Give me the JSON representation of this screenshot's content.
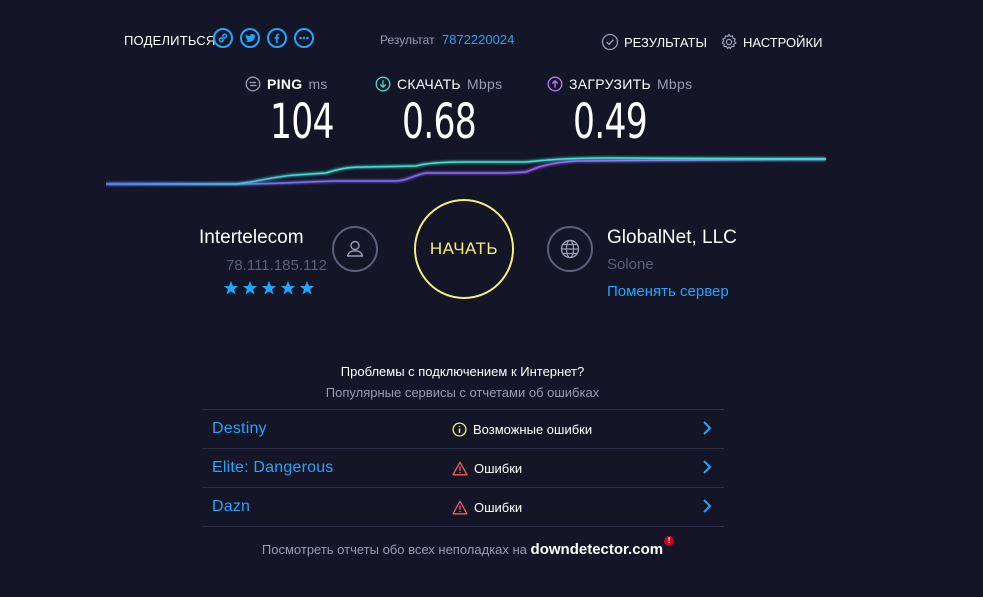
{
  "header": {
    "share_label": "ПОДЕЛИТЬСЯ",
    "share_icons": [
      "link-icon",
      "twitter-icon",
      "facebook-icon",
      "more-icon"
    ],
    "result_label": "Результат",
    "result_id": "7872220024",
    "results_label": "РЕЗУЛЬТАТЫ",
    "settings_label": "НАСТРОЙКИ"
  },
  "metrics": {
    "ping": {
      "label": "PING",
      "unit": "ms",
      "value": "104"
    },
    "download": {
      "label": "СКАЧАТЬ",
      "unit": "Mbps",
      "value": "0.68"
    },
    "upload": {
      "label": "ЗАГРУЗИТЬ",
      "unit": "Mbps",
      "value": "0.49"
    }
  },
  "colors": {
    "accent": "#1ea7ff",
    "download_line": "#3ee0d0",
    "upload_line": "#9b5cf5",
    "start_button": "#f4f07a",
    "warning": "#f4f07a",
    "error": "#e8625a"
  },
  "isp": {
    "name": "Intertelecom",
    "ip": "78.111.185.112",
    "rating": 5
  },
  "start_label": "НАЧАТЬ",
  "server": {
    "name": "GlobalNet, LLC",
    "location": "Solone",
    "change_label": "Поменять сервер"
  },
  "problems": {
    "title": "Проблемы с подключением к Интернет?",
    "subtitle": "Популярные сервисы с отчетами об ошибках",
    "items": [
      {
        "name": "Destiny",
        "status": "Возможные ошибки",
        "status_icon": "info-icon"
      },
      {
        "name": "Elite: Dangerous",
        "status": "Ошибки",
        "status_icon": "warning-icon"
      },
      {
        "name": "Dazn",
        "status": "Ошибки",
        "status_icon": "warning-icon"
      }
    ]
  },
  "footer": {
    "text": "Посмотреть отчеты обо всех неполадках на",
    "brand": "downdetector.com",
    "brand_mark": "!"
  }
}
